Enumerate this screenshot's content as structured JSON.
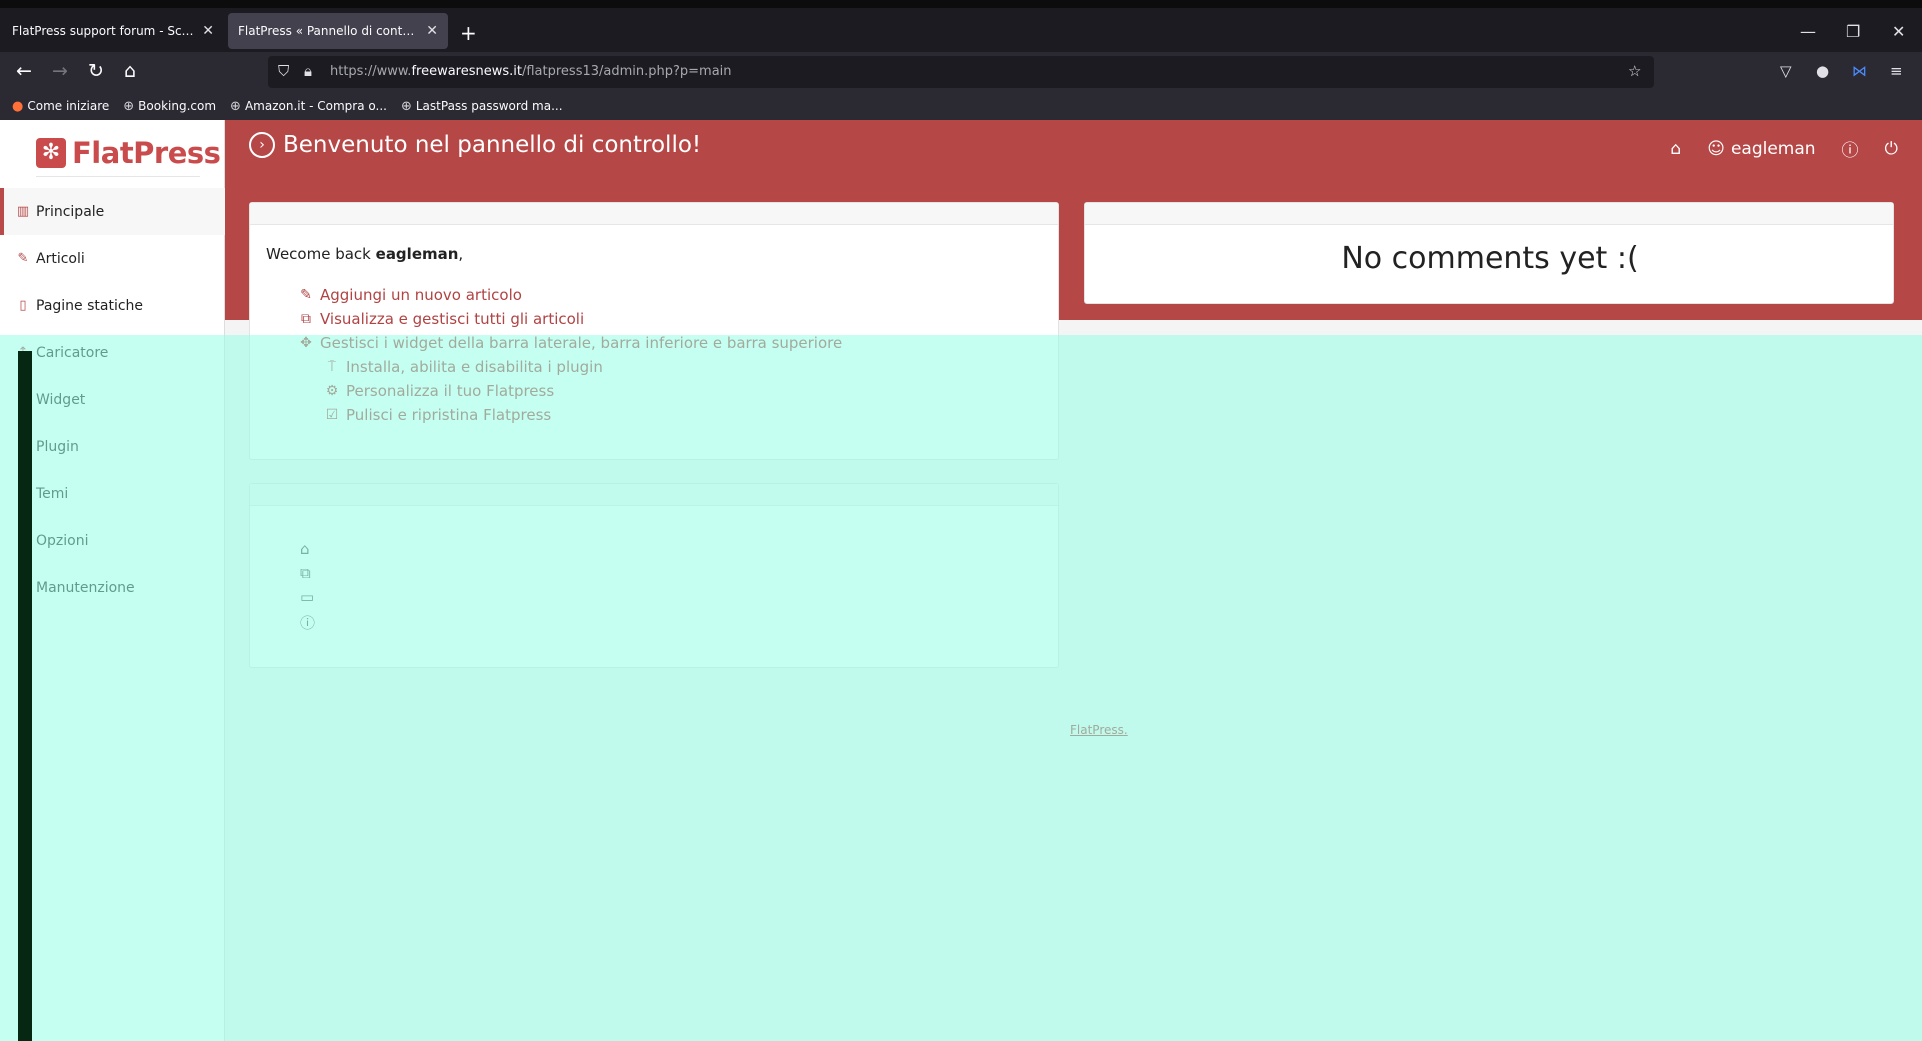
{
  "browser": {
    "tabs": [
      {
        "label": "FlatPress support forum - Scrivi un messaggio",
        "active": false
      },
      {
        "label": "FlatPress « Pannello di controllo « Principale",
        "active": true
      }
    ],
    "url_prefix": "https://www.",
    "url_host": "freewaresnews.it",
    "url_path": "/flatpress13/admin.php?p=main",
    "bookmarks": [
      "Come iniziare",
      "Booking.com",
      "Amazon.it - Compra o...",
      "LastPass password ma..."
    ]
  },
  "sidebar": {
    "logo": "FlatPress",
    "items": [
      {
        "label": "Principale",
        "icon": "chart-icon"
      },
      {
        "label": "Articoli",
        "icon": "pen-icon"
      },
      {
        "label": "Pagine statiche",
        "icon": "document-icon"
      },
      {
        "label": "Caricatore",
        "icon": "upload-icon"
      },
      {
        "label": "Widget",
        "icon": "move-icon"
      },
      {
        "label": "Plugin",
        "icon": "plug-icon"
      },
      {
        "label": "Temi",
        "icon": "palette-icon"
      },
      {
        "label": "Opzioni",
        "icon": "gear-icon"
      },
      {
        "label": "Manutenzione",
        "icon": "checkbox-icon"
      }
    ]
  },
  "header": {
    "title": "Benvenuto nel pannello di controllo!",
    "username": "eagleman"
  },
  "main": {
    "welcome_prefix": "Wecome back ",
    "welcome_user": "eagleman",
    "welcome_suffix": ",",
    "actions": [
      "Aggiungi un nuovo articolo",
      "Visualizza e gestisci tutti gli articoli",
      "Gestisci i widget della barra laterale, barra inferiore e barra superiore",
      "Installa, abilita e disabilita i plugin",
      "Personalizza il tuo Flatpress",
      "Pulisci e ripristina Flatpress"
    ],
    "comments_message": "No comments yet :(",
    "footer_link": "FlatPress",
    "footer_suffix": "."
  },
  "colors": {
    "brand": "#b64747",
    "chrome_dark": "#1c1b22",
    "overlay_cyan": "#a8fff0"
  }
}
